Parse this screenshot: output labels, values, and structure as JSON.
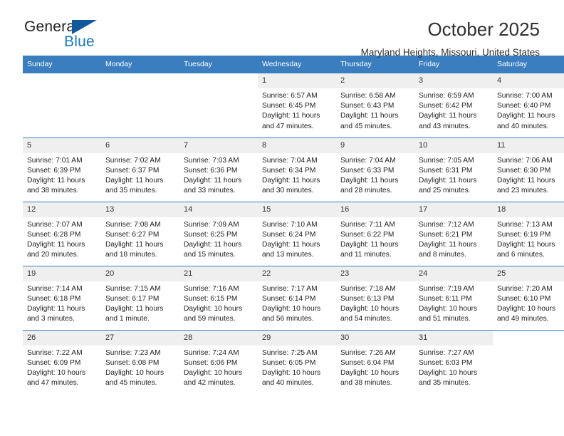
{
  "logo": {
    "word1": "General",
    "word2": "Blue",
    "flag_color": "#105a9c",
    "blue_color": "#1678c2"
  },
  "header": {
    "month_title": "October 2025",
    "location": "Maryland Heights, Missouri, United States",
    "header_bg": "#3a7ebf",
    "daynum_bg": "#efefef"
  },
  "weekdays": [
    "Sunday",
    "Monday",
    "Tuesday",
    "Wednesday",
    "Thursday",
    "Friday",
    "Saturday"
  ],
  "labels": {
    "sunrise": "Sunrise:",
    "sunset": "Sunset:",
    "daylight": "Daylight:"
  },
  "weeks": [
    [
      {
        "day": "",
        "sunrise": "",
        "sunset": "",
        "daylight": ""
      },
      {
        "day": "",
        "sunrise": "",
        "sunset": "",
        "daylight": ""
      },
      {
        "day": "",
        "sunrise": "",
        "sunset": "",
        "daylight": ""
      },
      {
        "day": "1",
        "sunrise": "Sunrise: 6:57 AM",
        "sunset": "Sunset: 6:45 PM",
        "daylight": "Daylight: 11 hours and 47 minutes."
      },
      {
        "day": "2",
        "sunrise": "Sunrise: 6:58 AM",
        "sunset": "Sunset: 6:43 PM",
        "daylight": "Daylight: 11 hours and 45 minutes."
      },
      {
        "day": "3",
        "sunrise": "Sunrise: 6:59 AM",
        "sunset": "Sunset: 6:42 PM",
        "daylight": "Daylight: 11 hours and 43 minutes."
      },
      {
        "day": "4",
        "sunrise": "Sunrise: 7:00 AM",
        "sunset": "Sunset: 6:40 PM",
        "daylight": "Daylight: 11 hours and 40 minutes."
      }
    ],
    [
      {
        "day": "5",
        "sunrise": "Sunrise: 7:01 AM",
        "sunset": "Sunset: 6:39 PM",
        "daylight": "Daylight: 11 hours and 38 minutes."
      },
      {
        "day": "6",
        "sunrise": "Sunrise: 7:02 AM",
        "sunset": "Sunset: 6:37 PM",
        "daylight": "Daylight: 11 hours and 35 minutes."
      },
      {
        "day": "7",
        "sunrise": "Sunrise: 7:03 AM",
        "sunset": "Sunset: 6:36 PM",
        "daylight": "Daylight: 11 hours and 33 minutes."
      },
      {
        "day": "8",
        "sunrise": "Sunrise: 7:04 AM",
        "sunset": "Sunset: 6:34 PM",
        "daylight": "Daylight: 11 hours and 30 minutes."
      },
      {
        "day": "9",
        "sunrise": "Sunrise: 7:04 AM",
        "sunset": "Sunset: 6:33 PM",
        "daylight": "Daylight: 11 hours and 28 minutes."
      },
      {
        "day": "10",
        "sunrise": "Sunrise: 7:05 AM",
        "sunset": "Sunset: 6:31 PM",
        "daylight": "Daylight: 11 hours and 25 minutes."
      },
      {
        "day": "11",
        "sunrise": "Sunrise: 7:06 AM",
        "sunset": "Sunset: 6:30 PM",
        "daylight": "Daylight: 11 hours and 23 minutes."
      }
    ],
    [
      {
        "day": "12",
        "sunrise": "Sunrise: 7:07 AM",
        "sunset": "Sunset: 6:28 PM",
        "daylight": "Daylight: 11 hours and 20 minutes."
      },
      {
        "day": "13",
        "sunrise": "Sunrise: 7:08 AM",
        "sunset": "Sunset: 6:27 PM",
        "daylight": "Daylight: 11 hours and 18 minutes."
      },
      {
        "day": "14",
        "sunrise": "Sunrise: 7:09 AM",
        "sunset": "Sunset: 6:25 PM",
        "daylight": "Daylight: 11 hours and 15 minutes."
      },
      {
        "day": "15",
        "sunrise": "Sunrise: 7:10 AM",
        "sunset": "Sunset: 6:24 PM",
        "daylight": "Daylight: 11 hours and 13 minutes."
      },
      {
        "day": "16",
        "sunrise": "Sunrise: 7:11 AM",
        "sunset": "Sunset: 6:22 PM",
        "daylight": "Daylight: 11 hours and 11 minutes."
      },
      {
        "day": "17",
        "sunrise": "Sunrise: 7:12 AM",
        "sunset": "Sunset: 6:21 PM",
        "daylight": "Daylight: 11 hours and 8 minutes."
      },
      {
        "day": "18",
        "sunrise": "Sunrise: 7:13 AM",
        "sunset": "Sunset: 6:19 PM",
        "daylight": "Daylight: 11 hours and 6 minutes."
      }
    ],
    [
      {
        "day": "19",
        "sunrise": "Sunrise: 7:14 AM",
        "sunset": "Sunset: 6:18 PM",
        "daylight": "Daylight: 11 hours and 3 minutes."
      },
      {
        "day": "20",
        "sunrise": "Sunrise: 7:15 AM",
        "sunset": "Sunset: 6:17 PM",
        "daylight": "Daylight: 11 hours and 1 minute."
      },
      {
        "day": "21",
        "sunrise": "Sunrise: 7:16 AM",
        "sunset": "Sunset: 6:15 PM",
        "daylight": "Daylight: 10 hours and 59 minutes."
      },
      {
        "day": "22",
        "sunrise": "Sunrise: 7:17 AM",
        "sunset": "Sunset: 6:14 PM",
        "daylight": "Daylight: 10 hours and 56 minutes."
      },
      {
        "day": "23",
        "sunrise": "Sunrise: 7:18 AM",
        "sunset": "Sunset: 6:13 PM",
        "daylight": "Daylight: 10 hours and 54 minutes."
      },
      {
        "day": "24",
        "sunrise": "Sunrise: 7:19 AM",
        "sunset": "Sunset: 6:11 PM",
        "daylight": "Daylight: 10 hours and 51 minutes."
      },
      {
        "day": "25",
        "sunrise": "Sunrise: 7:20 AM",
        "sunset": "Sunset: 6:10 PM",
        "daylight": "Daylight: 10 hours and 49 minutes."
      }
    ],
    [
      {
        "day": "26",
        "sunrise": "Sunrise: 7:22 AM",
        "sunset": "Sunset: 6:09 PM",
        "daylight": "Daylight: 10 hours and 47 minutes."
      },
      {
        "day": "27",
        "sunrise": "Sunrise: 7:23 AM",
        "sunset": "Sunset: 6:08 PM",
        "daylight": "Daylight: 10 hours and 45 minutes."
      },
      {
        "day": "28",
        "sunrise": "Sunrise: 7:24 AM",
        "sunset": "Sunset: 6:06 PM",
        "daylight": "Daylight: 10 hours and 42 minutes."
      },
      {
        "day": "29",
        "sunrise": "Sunrise: 7:25 AM",
        "sunset": "Sunset: 6:05 PM",
        "daylight": "Daylight: 10 hours and 40 minutes."
      },
      {
        "day": "30",
        "sunrise": "Sunrise: 7:26 AM",
        "sunset": "Sunset: 6:04 PM",
        "daylight": "Daylight: 10 hours and 38 minutes."
      },
      {
        "day": "31",
        "sunrise": "Sunrise: 7:27 AM",
        "sunset": "Sunset: 6:03 PM",
        "daylight": "Daylight: 10 hours and 35 minutes."
      },
      {
        "day": "",
        "sunrise": "",
        "sunset": "",
        "daylight": ""
      }
    ]
  ]
}
